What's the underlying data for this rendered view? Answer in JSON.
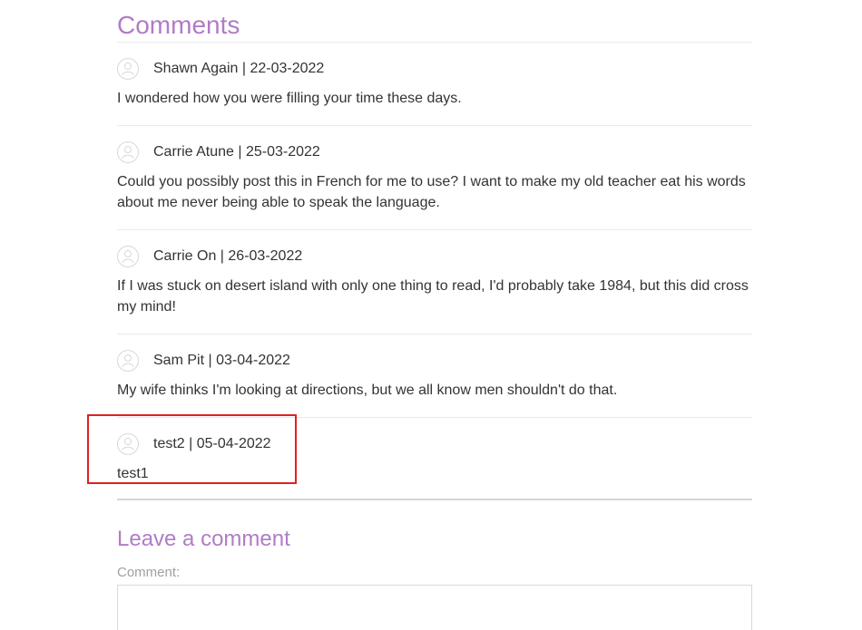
{
  "comments_section": {
    "title": "Comments",
    "items": [
      {
        "author": "Shawn Again",
        "date": "22-03-2022",
        "meta": "Shawn Again | 22-03-2022",
        "text": "I wondered how you were filling your time these days."
      },
      {
        "author": "Carrie Atune",
        "date": "25-03-2022",
        "meta": "Carrie Atune | 25-03-2022",
        "text": "Could you possibly post this in French for me to use? I want to make my old teacher eat his words about me never being able to speak the language."
      },
      {
        "author": "Carrie On",
        "date": "26-03-2022",
        "meta": "Carrie On | 26-03-2022",
        "text": "If I was stuck on desert island with only one thing to read, I'd probably take 1984, but this did cross my mind!"
      },
      {
        "author": "Sam Pit",
        "date": "03-04-2022",
        "meta": "Sam Pit | 03-04-2022",
        "text": "My wife thinks I'm looking at directions, but we all know men shouldn't do that."
      },
      {
        "author": "test2",
        "date": "05-04-2022",
        "meta": "test2 | 05-04-2022",
        "text": "test1"
      }
    ]
  },
  "leave_comment": {
    "title": "Leave a comment",
    "comment_label": "Comment:",
    "comment_value": ""
  },
  "colors": {
    "heading": "#b07cc6",
    "highlight": "#e02020"
  },
  "icons": {
    "avatar": "user-avatar-icon"
  }
}
